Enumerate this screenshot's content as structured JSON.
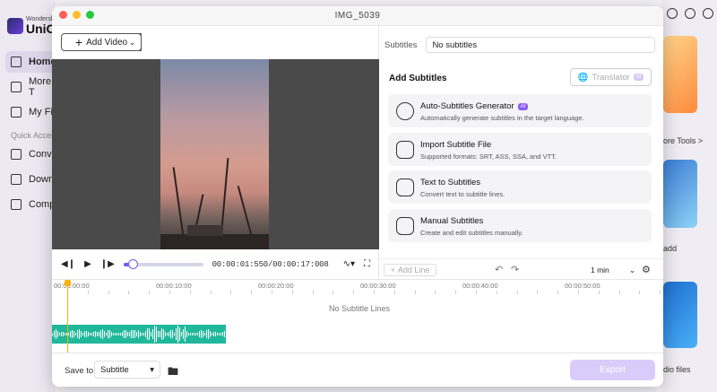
{
  "background_app": {
    "brand": {
      "line1": "Wondersh",
      "line2": "UniCo"
    },
    "nav": [
      {
        "label": "Home",
        "icon": "home-icon"
      },
      {
        "label": "More T",
        "icon": "toolbox-icon"
      },
      {
        "label": "My Fil",
        "icon": "files-icon"
      },
      {
        "label": "Conve",
        "icon": "convert-icon"
      },
      {
        "label": "Downl",
        "icon": "download-icon"
      },
      {
        "label": "Comp",
        "icon": "compress-icon"
      }
    ],
    "quick_access": "Quick Acces",
    "right_texts": {
      "more_tools": "ore Tools >",
      "add": "add",
      "audio_files": "dio files"
    }
  },
  "window": {
    "title": "IMG_5039",
    "add_video_label": "Add Video"
  },
  "player": {
    "timecode": "00:00:01:550/00:00:17:008",
    "progress_fraction": 0.09
  },
  "subtitles": {
    "label": "Subtitles",
    "value": "No subtitles",
    "add_title": "Add Subtitles",
    "translator_label": "Translator",
    "translator_badge": "AI",
    "options": [
      {
        "title": "Auto-Subtitles Generator",
        "badge": "AI",
        "desc": "Automatically generate subtitles in the target language.",
        "icon": "auto-subtitle-icon"
      },
      {
        "title": "Import Subtitle File",
        "badge": "",
        "desc": "Supported formats: SRT, ASS, SSA, and VTT.",
        "icon": "import-file-icon"
      },
      {
        "title": "Text to Subtitles",
        "badge": "",
        "desc": "Convert text to subtitle lines.",
        "icon": "text-to-subtitle-icon"
      },
      {
        "title": "Manual Subtitles",
        "badge": "",
        "desc": "Create and edit subtitles manually.",
        "icon": "manual-subtitle-icon"
      }
    ],
    "add_line_label": "Add Line",
    "duration": "1 min"
  },
  "timeline": {
    "ticks": [
      "00:00:00:00",
      "00:00:10:00",
      "00:00:20:00",
      "00:00:30:00",
      "00:00:40:00",
      "00:00:50:00"
    ],
    "empty_text": "No Subtitle Lines"
  },
  "footer": {
    "save_to_label": "Save to",
    "save_to_value": "Subtitle",
    "export_label": "Export"
  },
  "colors": {
    "accent": "#6a5cf5",
    "waveform": "#20b89b",
    "playhead": "#f4b400",
    "export_disabled": "#d9ccfb"
  }
}
